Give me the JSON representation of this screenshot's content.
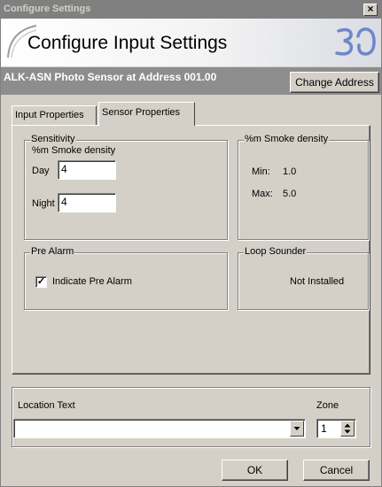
{
  "window": {
    "title": "Configure Settings",
    "close_glyph": "×"
  },
  "banner": {
    "heading": "Configure Input Settings",
    "logo_icon": "brand-logo-icon"
  },
  "device": {
    "name": "ALK-ASN Photo Sensor at Address 001.00",
    "change_address_label": "Change Address"
  },
  "tabs": [
    {
      "label": "Input Properties",
      "active": false
    },
    {
      "label": "Sensor Properties",
      "active": true
    }
  ],
  "sensitivity": {
    "legend": "Sensitivity",
    "unit_label": "%m Smoke density",
    "day_label": "Day",
    "day_value": "4",
    "night_label": "Night",
    "night_value": "4"
  },
  "smoke_density": {
    "legend": "%m Smoke density",
    "min_label": "Min:",
    "min_value": "1.0",
    "max_label": "Max:",
    "max_value": "5.0"
  },
  "pre_alarm": {
    "legend": "Pre Alarm",
    "checkbox_label": "Indicate Pre Alarm",
    "checked": true,
    "check_glyph": "✓"
  },
  "loop_sounder": {
    "legend": "Loop Sounder",
    "status": "Not Installed"
  },
  "location": {
    "label": "Location Text",
    "value": "",
    "zone_label": "Zone",
    "zone_value": "1"
  },
  "footer": {
    "ok_label": "OK",
    "cancel_label": "Cancel"
  },
  "colors": {
    "face": "#d4d0c8",
    "titlebar": "#808080",
    "device_bar": "#8d8d8d",
    "logo_blue": "#6f86c9"
  }
}
